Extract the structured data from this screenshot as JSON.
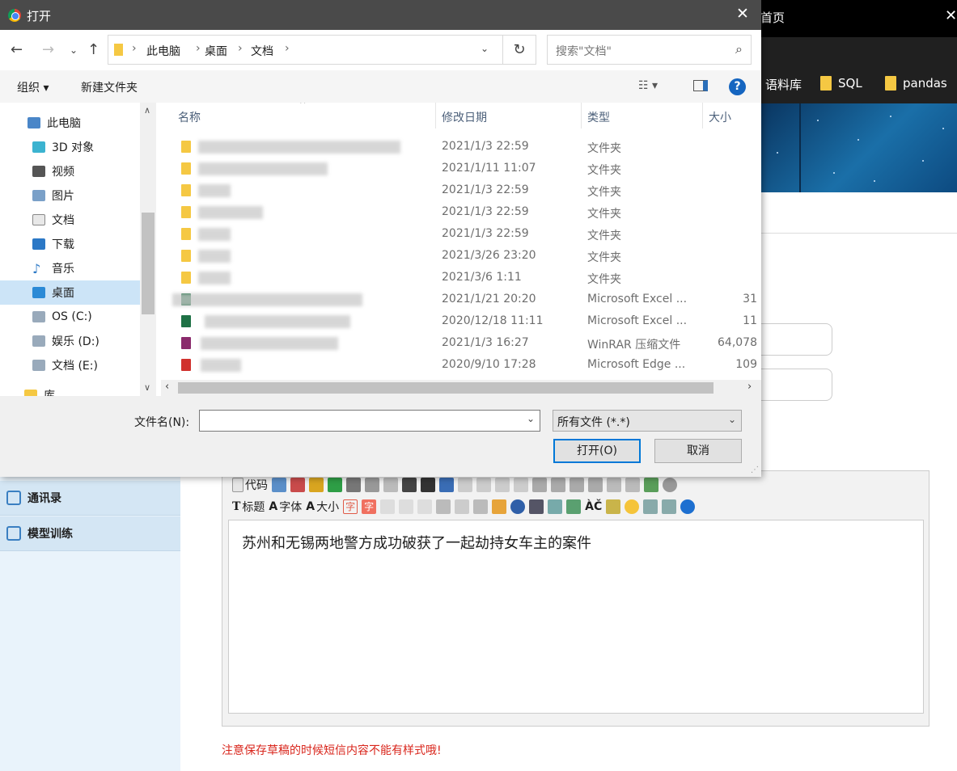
{
  "background": {
    "top_title": "首页",
    "close": "✕",
    "bookmarks": [
      "语料库",
      "SQL",
      "pandas"
    ],
    "nav": [
      {
        "label": "通讯录"
      },
      {
        "label": "模型训练"
      }
    ],
    "toolbar_row1": {
      "label1": "代码"
    },
    "toolbar_row2": {
      "label1": "标题",
      "label2": "字体",
      "label3": "大小",
      "char": "字"
    },
    "editor_text": "苏州和无锡两地警方成功破获了一起劫持女车主的案件",
    "warning": "注意保存草稿的时候短信内容不能有样式哦!"
  },
  "dialog": {
    "title": "打开",
    "close": "✕",
    "breadcrumb": [
      "此电脑",
      "桌面",
      "文档"
    ],
    "search_placeholder": "搜索\"文档\"",
    "organize": "组织 ▾",
    "new_folder": "新建文件夹",
    "help": "?",
    "tree": [
      {
        "label": "此电脑",
        "icon": "computer-icon"
      },
      {
        "label": "3D 对象",
        "icon": "cube-icon"
      },
      {
        "label": "视频",
        "icon": "video-icon"
      },
      {
        "label": "图片",
        "icon": "picture-icon"
      },
      {
        "label": "文档",
        "icon": "document-icon"
      },
      {
        "label": "下载",
        "icon": "download-icon"
      },
      {
        "label": "音乐",
        "icon": "music-icon"
      },
      {
        "label": "桌面",
        "icon": "desktop-icon"
      },
      {
        "label": "OS (C:)",
        "icon": "drive-icon"
      },
      {
        "label": "娱乐 (D:)",
        "icon": "drive-icon"
      },
      {
        "label": "文档 (E:)",
        "icon": "drive-icon"
      },
      {
        "label": "库",
        "icon": "library-icon"
      }
    ],
    "columns": {
      "name": "名称",
      "date": "修改日期",
      "type": "类型",
      "size": "大小"
    },
    "rows": [
      {
        "date": "2021/1/3 22:59",
        "type": "文件夹",
        "size": "",
        "icon": "folder-icon"
      },
      {
        "date": "2021/1/11 11:07",
        "type": "文件夹",
        "size": "",
        "icon": "folder-icon"
      },
      {
        "date": "2021/1/3 22:59",
        "type": "文件夹",
        "size": "",
        "icon": "folder-icon"
      },
      {
        "date": "2021/1/3 22:59",
        "type": "文件夹",
        "size": "",
        "icon": "folder-icon"
      },
      {
        "date": "2021/1/3 22:59",
        "type": "文件夹",
        "size": "",
        "icon": "folder-icon"
      },
      {
        "date": "2021/3/26 23:20",
        "type": "文件夹",
        "size": "",
        "icon": "folder-icon"
      },
      {
        "date": "2021/3/6 1:11",
        "type": "文件夹",
        "size": "",
        "icon": "folder-icon"
      },
      {
        "date": "2021/1/21 20:20",
        "type": "Microsoft Excel ...",
        "size": "31",
        "icon": "excel-icon"
      },
      {
        "date": "2020/12/18 11:11",
        "type": "Microsoft Excel ...",
        "size": "11",
        "icon": "excel-icon"
      },
      {
        "date": "2021/1/3 16:27",
        "type": "WinRAR 压缩文件",
        "size": "64,078",
        "icon": "winrar-icon"
      },
      {
        "date": "2020/9/10 17:28",
        "type": "Microsoft Edge ...",
        "size": "109",
        "icon": "pdf-icon"
      }
    ],
    "filename_label": "文件名(N):",
    "filename_value": "",
    "filetype": "所有文件 (*.*)",
    "open_button": "打开(O)",
    "cancel_button": "取消"
  }
}
